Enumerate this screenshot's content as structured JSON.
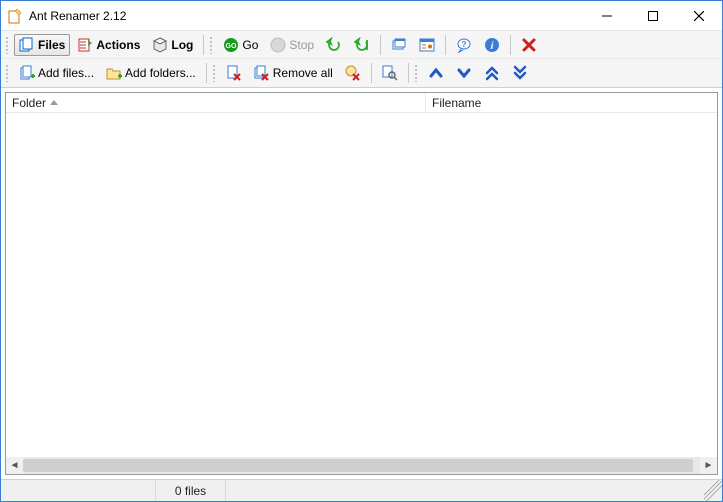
{
  "window": {
    "title": "Ant Renamer 2.12"
  },
  "toolbar1": {
    "files": "Files",
    "actions": "Actions",
    "log": "Log",
    "go": "Go",
    "stop": "Stop"
  },
  "toolbar2": {
    "add_files": "Add files...",
    "add_folders": "Add folders...",
    "remove_all": "Remove all"
  },
  "columns": {
    "folder": "Folder",
    "filename": "Filename"
  },
  "status": {
    "file_count": "0 files"
  }
}
